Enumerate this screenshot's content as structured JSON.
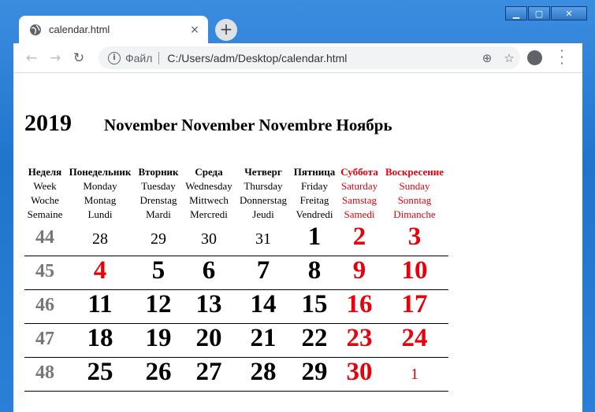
{
  "browser": {
    "tab_title": "calendar.html",
    "tab_close": "×",
    "new_tab": "+",
    "scheme_label": "Файл",
    "url": "C:/Users/adm/Desktop/calendar.html",
    "window_controls": [
      "▁",
      "▢",
      "✕"
    ]
  },
  "calendar": {
    "year": "2019",
    "month_title": "November November Novembre Ноябрь",
    "headers": [
      {
        "ru": "Неделя",
        "en": "Week",
        "de": "Woche",
        "fr": "Semaine",
        "red": false
      },
      {
        "ru": "Понедельник",
        "en": "Monday",
        "de": "Montag",
        "fr": "Lundi",
        "red": false
      },
      {
        "ru": "Вторник",
        "en": "Tuesday",
        "de": "Drenstag",
        "fr": "Mardi",
        "red": false
      },
      {
        "ru": "Среда",
        "en": "Wednesday",
        "de": "Mittwech",
        "fr": "Mercredi",
        "red": false
      },
      {
        "ru": "Четверг",
        "en": "Thursday",
        "de": "Donnerstag",
        "fr": "Jeudi",
        "red": false
      },
      {
        "ru": "Пятница",
        "en": "Friday",
        "de": "Freitag",
        "fr": "Vendredi",
        "red": false
      },
      {
        "ru": "Суббота",
        "en": "Saturday",
        "de": "Samstag",
        "fr": "Samedi",
        "red": true
      },
      {
        "ru": "Воскресение",
        "en": "Sunday",
        "de": "Sonntag",
        "fr": "Dimanche",
        "red": true
      }
    ],
    "weeks": [
      {
        "week": "44",
        "days": [
          "28",
          "29",
          "30",
          "31",
          "1",
          "2",
          "3"
        ],
        "other_month": [
          true,
          true,
          true,
          true,
          false,
          false,
          false
        ]
      },
      {
        "week": "45",
        "days": [
          "4",
          "5",
          "6",
          "7",
          "8",
          "9",
          "10"
        ],
        "other_month": [
          false,
          false,
          false,
          false,
          false,
          false,
          false
        ]
      },
      {
        "week": "46",
        "days": [
          "11",
          "12",
          "13",
          "14",
          "15",
          "16",
          "17"
        ],
        "other_month": [
          false,
          false,
          false,
          false,
          false,
          false,
          false
        ]
      },
      {
        "week": "47",
        "days": [
          "18",
          "19",
          "20",
          "21",
          "22",
          "23",
          "24"
        ],
        "other_month": [
          false,
          false,
          false,
          false,
          false,
          false,
          false
        ]
      },
      {
        "week": "48",
        "days": [
          "25",
          "26",
          "27",
          "28",
          "29",
          "30",
          "1"
        ],
        "other_month": [
          false,
          false,
          false,
          false,
          false,
          false,
          true
        ]
      }
    ],
    "red_days": [
      [
        false,
        false,
        false,
        false,
        false,
        true,
        true
      ],
      [
        true,
        false,
        false,
        false,
        false,
        true,
        true
      ],
      [
        false,
        false,
        false,
        false,
        false,
        true,
        true
      ],
      [
        false,
        false,
        false,
        false,
        false,
        true,
        true
      ],
      [
        false,
        false,
        false,
        false,
        false,
        true,
        true
      ]
    ],
    "colors": {
      "holiday": "#e8000b",
      "week_number": "#777777"
    }
  }
}
